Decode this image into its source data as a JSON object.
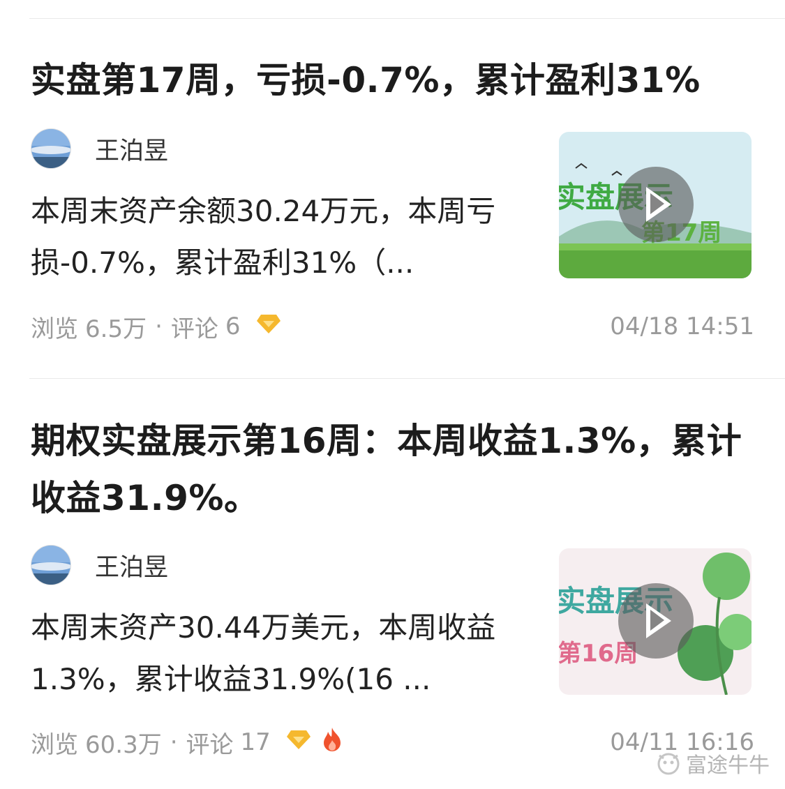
{
  "posts": [
    {
      "title": "实盘第17周，亏损-0.7%，累计盈利31%",
      "author": "王泊昱",
      "summary": "本周末资产余额30.24万元，本周亏损-0.7%，累计盈利31%（...",
      "thumbnail": {
        "title_text": "实盘展示",
        "week_text": "第17周"
      },
      "views_label": "浏览",
      "views": "6.5万",
      "separator": "·",
      "comments_label": "评论",
      "comments": "6",
      "badges": [
        "diamond-icon"
      ],
      "time": "04/18 14:51"
    },
    {
      "title": "期权实盘展示第16周：本周收益1.3%，累计收益31.9%。",
      "author": "王泊昱",
      "summary": "本周末资产30.44万美元，本周收益1.3%，累计收益31.9%(16 ...",
      "thumbnail": {
        "title_text": "实盘展示",
        "week_text": "第16周"
      },
      "views_label": "浏览",
      "views": "60.3万",
      "separator": "·",
      "comments_label": "评论",
      "comments": "17",
      "badges": [
        "diamond-icon",
        "fire-icon"
      ],
      "time": "04/11 16:16"
    }
  ],
  "watermark": {
    "text": "富途牛牛"
  },
  "colors": {
    "diamond": "#f5b82e",
    "fire": "#f0522d",
    "meta_text": "#9a9a9a"
  }
}
